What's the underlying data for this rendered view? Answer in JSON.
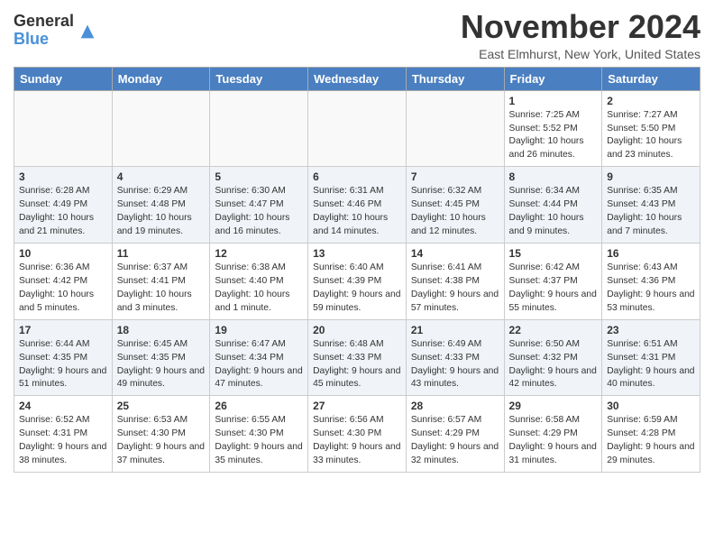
{
  "header": {
    "logo_general": "General",
    "logo_blue": "Blue",
    "title": "November 2024",
    "location": "East Elmhurst, New York, United States"
  },
  "days_of_week": [
    "Sunday",
    "Monday",
    "Tuesday",
    "Wednesday",
    "Thursday",
    "Friday",
    "Saturday"
  ],
  "weeks": [
    [
      {
        "day": "",
        "info": ""
      },
      {
        "day": "",
        "info": ""
      },
      {
        "day": "",
        "info": ""
      },
      {
        "day": "",
        "info": ""
      },
      {
        "day": "",
        "info": ""
      },
      {
        "day": "1",
        "info": "Sunrise: 7:25 AM\nSunset: 5:52 PM\nDaylight: 10 hours and 26 minutes."
      },
      {
        "day": "2",
        "info": "Sunrise: 7:27 AM\nSunset: 5:50 PM\nDaylight: 10 hours and 23 minutes."
      }
    ],
    [
      {
        "day": "3",
        "info": "Sunrise: 6:28 AM\nSunset: 4:49 PM\nDaylight: 10 hours and 21 minutes."
      },
      {
        "day": "4",
        "info": "Sunrise: 6:29 AM\nSunset: 4:48 PM\nDaylight: 10 hours and 19 minutes."
      },
      {
        "day": "5",
        "info": "Sunrise: 6:30 AM\nSunset: 4:47 PM\nDaylight: 10 hours and 16 minutes."
      },
      {
        "day": "6",
        "info": "Sunrise: 6:31 AM\nSunset: 4:46 PM\nDaylight: 10 hours and 14 minutes."
      },
      {
        "day": "7",
        "info": "Sunrise: 6:32 AM\nSunset: 4:45 PM\nDaylight: 10 hours and 12 minutes."
      },
      {
        "day": "8",
        "info": "Sunrise: 6:34 AM\nSunset: 4:44 PM\nDaylight: 10 hours and 9 minutes."
      },
      {
        "day": "9",
        "info": "Sunrise: 6:35 AM\nSunset: 4:43 PM\nDaylight: 10 hours and 7 minutes."
      }
    ],
    [
      {
        "day": "10",
        "info": "Sunrise: 6:36 AM\nSunset: 4:42 PM\nDaylight: 10 hours and 5 minutes."
      },
      {
        "day": "11",
        "info": "Sunrise: 6:37 AM\nSunset: 4:41 PM\nDaylight: 10 hours and 3 minutes."
      },
      {
        "day": "12",
        "info": "Sunrise: 6:38 AM\nSunset: 4:40 PM\nDaylight: 10 hours and 1 minute."
      },
      {
        "day": "13",
        "info": "Sunrise: 6:40 AM\nSunset: 4:39 PM\nDaylight: 9 hours and 59 minutes."
      },
      {
        "day": "14",
        "info": "Sunrise: 6:41 AM\nSunset: 4:38 PM\nDaylight: 9 hours and 57 minutes."
      },
      {
        "day": "15",
        "info": "Sunrise: 6:42 AM\nSunset: 4:37 PM\nDaylight: 9 hours and 55 minutes."
      },
      {
        "day": "16",
        "info": "Sunrise: 6:43 AM\nSunset: 4:36 PM\nDaylight: 9 hours and 53 minutes."
      }
    ],
    [
      {
        "day": "17",
        "info": "Sunrise: 6:44 AM\nSunset: 4:35 PM\nDaylight: 9 hours and 51 minutes."
      },
      {
        "day": "18",
        "info": "Sunrise: 6:45 AM\nSunset: 4:35 PM\nDaylight: 9 hours and 49 minutes."
      },
      {
        "day": "19",
        "info": "Sunrise: 6:47 AM\nSunset: 4:34 PM\nDaylight: 9 hours and 47 minutes."
      },
      {
        "day": "20",
        "info": "Sunrise: 6:48 AM\nSunset: 4:33 PM\nDaylight: 9 hours and 45 minutes."
      },
      {
        "day": "21",
        "info": "Sunrise: 6:49 AM\nSunset: 4:33 PM\nDaylight: 9 hours and 43 minutes."
      },
      {
        "day": "22",
        "info": "Sunrise: 6:50 AM\nSunset: 4:32 PM\nDaylight: 9 hours and 42 minutes."
      },
      {
        "day": "23",
        "info": "Sunrise: 6:51 AM\nSunset: 4:31 PM\nDaylight: 9 hours and 40 minutes."
      }
    ],
    [
      {
        "day": "24",
        "info": "Sunrise: 6:52 AM\nSunset: 4:31 PM\nDaylight: 9 hours and 38 minutes."
      },
      {
        "day": "25",
        "info": "Sunrise: 6:53 AM\nSunset: 4:30 PM\nDaylight: 9 hours and 37 minutes."
      },
      {
        "day": "26",
        "info": "Sunrise: 6:55 AM\nSunset: 4:30 PM\nDaylight: 9 hours and 35 minutes."
      },
      {
        "day": "27",
        "info": "Sunrise: 6:56 AM\nSunset: 4:30 PM\nDaylight: 9 hours and 33 minutes."
      },
      {
        "day": "28",
        "info": "Sunrise: 6:57 AM\nSunset: 4:29 PM\nDaylight: 9 hours and 32 minutes."
      },
      {
        "day": "29",
        "info": "Sunrise: 6:58 AM\nSunset: 4:29 PM\nDaylight: 9 hours and 31 minutes."
      },
      {
        "day": "30",
        "info": "Sunrise: 6:59 AM\nSunset: 4:28 PM\nDaylight: 9 hours and 29 minutes."
      }
    ]
  ]
}
